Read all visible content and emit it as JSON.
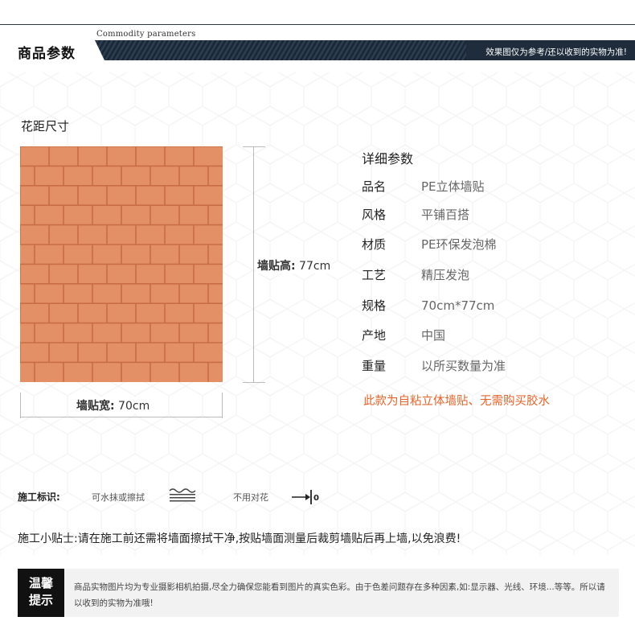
{
  "header": {
    "title_en": "Commodity parameters",
    "title_cn": "商品参数",
    "note": "效果图仅为参考/还以收到的实物为准!"
  },
  "section_title": "花距尺寸",
  "dimensions": {
    "height_key": "墙贴高:",
    "height_val": " 77cm",
    "width_key": "墙贴宽:",
    "width_val": " 70cm"
  },
  "colors": {
    "brick": "#e49066",
    "brick_dark": "#c96d45",
    "accent": "#e0652c",
    "header_dark": "#1e2c3c"
  },
  "params": {
    "title": "详细参数",
    "rows": [
      {
        "k": "品名",
        "v": "PE立体墙贴"
      },
      {
        "k": "风格",
        "v": "平铺百搭"
      },
      {
        "k": "材质",
        "v": "PE环保发泡棉"
      },
      {
        "k": "工艺",
        "v": "精压发泡"
      },
      {
        "k": "规格",
        "v": "70cm*77cm"
      },
      {
        "k": "产地",
        "v": "中国"
      },
      {
        "k": "重量",
        "v": "以所买数量为准"
      }
    ],
    "note": "此款为自粘立体墙贴、无需购买胶水"
  },
  "construction": {
    "label": "施工标识:",
    "item1": "可水抹或擦拭",
    "icon1": "wipe-icon",
    "item2": "不用对花",
    "icon2": "no-pattern-alignment-icon",
    "icon2_text": "0"
  },
  "tips": "施工小贴士:请在施工前还需将墙面擦拭干净,按贴墙面测量后裁剪墙贴后再上墙,以免浪费!",
  "notice": {
    "tag_line1": "温馨",
    "tag_line2": "提示",
    "text": "商品实物图片均为专业摄影相机拍摄,尽全力确保您能看到图片的真实色彩。由于色差问题存在多种因素,如:显示器、光线、环境...等等。所以请以收到的实物为准哦!"
  }
}
